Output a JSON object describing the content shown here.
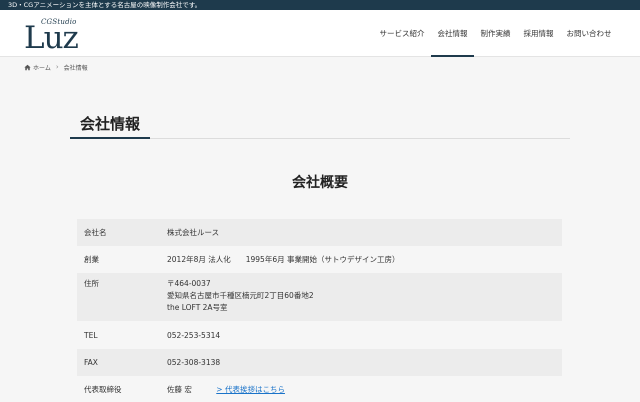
{
  "topbar": {
    "tagline": "3D・CGアニメーションを主体とする名古屋の映像制作会社です。"
  },
  "logo": {
    "sub": "CGStudio",
    "main": "Luz"
  },
  "nav": {
    "items": [
      {
        "label": "サービス紹介",
        "active": false
      },
      {
        "label": "会社情報",
        "active": true
      },
      {
        "label": "制作実績",
        "active": false
      },
      {
        "label": "採用情報",
        "active": false
      },
      {
        "label": "お問い合わせ",
        "active": false
      }
    ]
  },
  "breadcrumb": {
    "home": "ホーム",
    "current": "会社情報"
  },
  "page": {
    "title": "会社情報",
    "section_title": "会社概要"
  },
  "company": {
    "name_label": "会社名",
    "name_value": "株式会社ルース",
    "founded_label": "創業",
    "founded_value": "2012年8月 法人化　　1995年6月 事業開始（サトウデザイン工房）",
    "address_label": "住所",
    "address_zip": "〒464-0037",
    "address_line1": "愛知県名古屋市千種区楠元町2丁目60番地2",
    "address_line2": "the LOFT 2A号室",
    "tel_label": "TEL",
    "tel_value": "052-253-5314",
    "fax_label": "FAX",
    "fax_value": "052-308-3138",
    "ceo_label": "代表取締役",
    "ceo_value": "佐藤 宏",
    "ceo_link": "> 代表挨拶はこちら"
  },
  "colors": {
    "brand": "#1e3a4c",
    "link": "#1a73c9",
    "shaded_row": "#ececec"
  }
}
